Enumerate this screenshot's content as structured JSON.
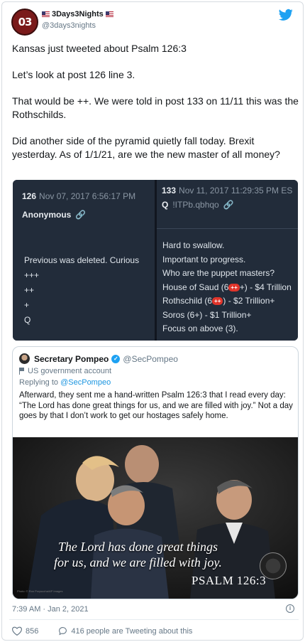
{
  "tweet": {
    "display_name": "3Days3Nights",
    "handle": "@3days3nights",
    "avatar_text": "03",
    "paragraphs": [
      "Kansas just tweeted about Psalm 126:3",
      "Let’s look at post 126 line 3.",
      "That would be ++. We were told in post 133 on 11/11 this was the Rothschilds.",
      "Did another side of the pyramid quietly fall today. Brexit yesterday. As of 1/1/21, are we the new master of all money?"
    ],
    "timestamp": "7:39 AM · Jan 2, 2021",
    "likes": "856",
    "tweeting_about": "416 people are Tweeting about this"
  },
  "qdrop": {
    "left": {
      "num": "126",
      "date": "Nov 07, 2017 6:56:17 PM",
      "name": "Anonymous",
      "lines": [
        "Previous was deleted. Curious",
        "+++",
        "++",
        "+",
        "Q"
      ]
    },
    "right": {
      "num": "133",
      "date": "Nov 11, 2017 11:29:35 PM ES",
      "name": "Q",
      "trip": "!ITPb.qbhqo",
      "lines": [
        "Hard to swallow.",
        "Important to progress.",
        "Who are the puppet masters?"
      ],
      "saud_pre": "House of Saud (6",
      "saud_badge": "++",
      "saud_post": "+) - $4 Trillion",
      "roth_pre": "Rothschild (6",
      "roth_badge": "++",
      "roth_post": ") - $2 Trillion+",
      "soros": "Soros (6+) - $1 Trillion+",
      "focus": "Focus on above (3)."
    }
  },
  "quote": {
    "name": "Secretary Pompeo",
    "handle": "@SecPompeo",
    "label": "US government account",
    "replying_prefix": "Replying to",
    "replying_to": "@SecPompeo",
    "text": "Afterward, they sent me a hand-written Psalm 126:3 that I read every day: “The Lord has done great things for us, and we are filled with joy.” Not a day goes by that I don’t work to get our hostages safely home.",
    "caption_line1": "The Lord has done great things",
    "caption_line2": "for us, and we are filled with joy.",
    "psalm": "PSALM 126:3",
    "credit": "Photo: © Ron Przysucha/AP Images"
  },
  "colors": {
    "accent": "#1da1f2",
    "qbg": "#222c3a",
    "badge": "#e0352b"
  },
  "icons": [
    "twitter-bird-icon",
    "link-icon",
    "verified-icon",
    "government-flag-icon",
    "info-icon",
    "heart-icon",
    "comment-icon"
  ]
}
